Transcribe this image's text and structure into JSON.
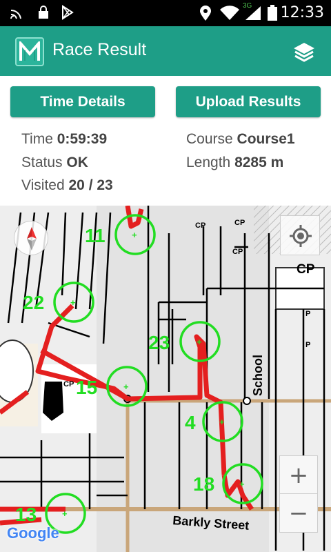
{
  "status_bar": {
    "time": "12:33",
    "network": "3G"
  },
  "app": {
    "title": "Race Result"
  },
  "buttons": {
    "time_details": "Time Details",
    "upload_results": "Upload Results"
  },
  "results": {
    "time_label": "Time",
    "time_value": "0:59:39",
    "status_label": "Status",
    "status_value": "OK",
    "visited_label": "Visited",
    "visited_value": "20 / 23",
    "course_label": "Course",
    "course_value": "Course1",
    "length_label": "Length",
    "length_value": "8285 m"
  },
  "map": {
    "street_school": "School",
    "street_barkly": "Barkly Street",
    "cp_label": "CP",
    "parking": "P",
    "attribution": "Google",
    "zoom_in": "+",
    "zoom_out": "−",
    "control_numbers": [
      "11",
      "22",
      "23",
      "15",
      "4",
      "18",
      "13"
    ],
    "route_color": "#e41f1f",
    "control_color": "#22dd22"
  },
  "colors": {
    "accent": "#1e9e87",
    "statusbar": "#000000"
  }
}
